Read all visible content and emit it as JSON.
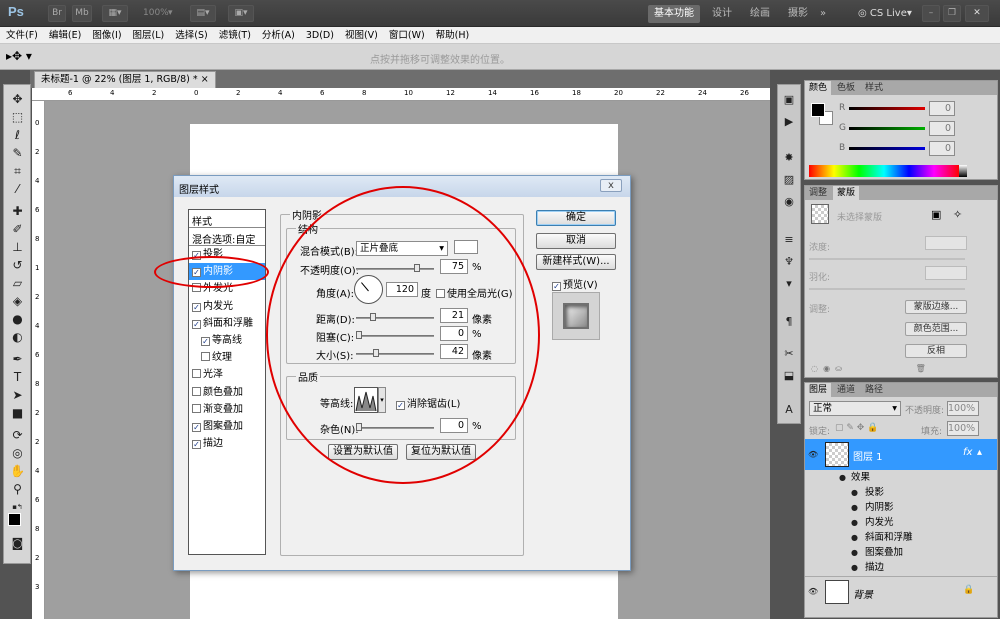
{
  "app": {
    "logo": "Ps",
    "zoom": "100%",
    "cs_live": "CS Live",
    "workspaces": [
      "基本功能",
      "设计",
      "绘画",
      "摄影"
    ]
  },
  "menu": [
    "文件(F)",
    "编辑(E)",
    "图像(I)",
    "图层(L)",
    "选择(S)",
    "滤镜(T)",
    "分析(A)",
    "3D(D)",
    "视图(V)",
    "窗口(W)",
    "帮助(H)"
  ],
  "options": {
    "hint": "点按并拖移可调整效果的位置。"
  },
  "doc": {
    "tab": "未标题-1 @ 22% (图层 1, RGB/8) *"
  },
  "ruler_h": [
    "6",
    "4",
    "2",
    "0",
    "2",
    "4",
    "6",
    "8",
    "10",
    "12",
    "14",
    "16",
    "18",
    "20",
    "22",
    "24",
    "26"
  ],
  "ruler_v": [
    "0",
    "2",
    "4",
    "6",
    "8",
    "1",
    "2",
    "4",
    "6",
    "8",
    "2",
    "2",
    "4",
    "6",
    "8",
    "2",
    "3"
  ],
  "dialog": {
    "title": "图层样式",
    "close": "x",
    "styles_header": "样式",
    "blend_options": "混合选项:自定",
    "styles": [
      {
        "label": "投影",
        "checked": true
      },
      {
        "label": "内阴影",
        "checked": true,
        "selected": true
      },
      {
        "label": "外发光",
        "checked": false
      },
      {
        "label": "内发光",
        "checked": true
      },
      {
        "label": "斜面和浮雕",
        "checked": true
      },
      {
        "label": "等高线",
        "checked": true
      },
      {
        "label": "纹理",
        "checked": false
      },
      {
        "label": "光泽",
        "checked": false
      },
      {
        "label": "颜色叠加",
        "checked": false
      },
      {
        "label": "渐变叠加",
        "checked": false
      },
      {
        "label": "图案叠加",
        "checked": true
      },
      {
        "label": "描边",
        "checked": true
      }
    ],
    "section_title": "内阴影",
    "structure": {
      "title": "结构",
      "blend_mode_label": "混合模式(B):",
      "blend_mode_value": "正片叠底",
      "opacity_label": "不透明度(O):",
      "opacity_value": "75",
      "percent": "%",
      "angle_label": "角度(A):",
      "angle_value": "120",
      "angle_unit": "度",
      "global_light": "使用全局光(G)",
      "distance_label": "距离(D):",
      "distance_value": "21",
      "choke_label": "阻塞(C):",
      "choke_value": "0",
      "size_label": "大小(S):",
      "size_value": "42",
      "unit_px": "像素"
    },
    "quality": {
      "title": "品质",
      "contour_label": "等高线:",
      "antialias": "消除锯齿(L)",
      "noise_label": "杂色(N):",
      "noise_value": "0"
    },
    "set_default": "设置为默认值",
    "reset_default": "复位为默认值",
    "ok": "确定",
    "cancel": "取消",
    "new_style": "新建样式(W)...",
    "preview": "预览(V)"
  },
  "color_panel": {
    "tabs": [
      "颜色",
      "色板",
      "样式"
    ],
    "r": "R",
    "g": "G",
    "b": "B",
    "r_value": "0",
    "g_value": "0",
    "b_value": "0"
  },
  "adjust_panel": {
    "tabs": [
      "调整",
      "蒙版"
    ],
    "no_mask": "未选择蒙版",
    "density": "浓度:",
    "feather": "羽化:",
    "refine": "调整:",
    "mask_edge": "蒙版边缘...",
    "color_range": "颜色范围...",
    "invert": "反相"
  },
  "layers_panel": {
    "tabs": [
      "图层",
      "通道",
      "路径"
    ],
    "blend": "正常",
    "opacity_label": "不透明度:",
    "opacity": "100%",
    "lock_label": "锁定:",
    "fill_label": "填充:",
    "fill": "100%",
    "layer1": "图层 1",
    "fx": "fx",
    "effects_label": "效果",
    "effects": [
      "投影",
      "内阴影",
      "内发光",
      "斜面和浮雕",
      "图案叠加",
      "描边"
    ],
    "background": "背景"
  }
}
